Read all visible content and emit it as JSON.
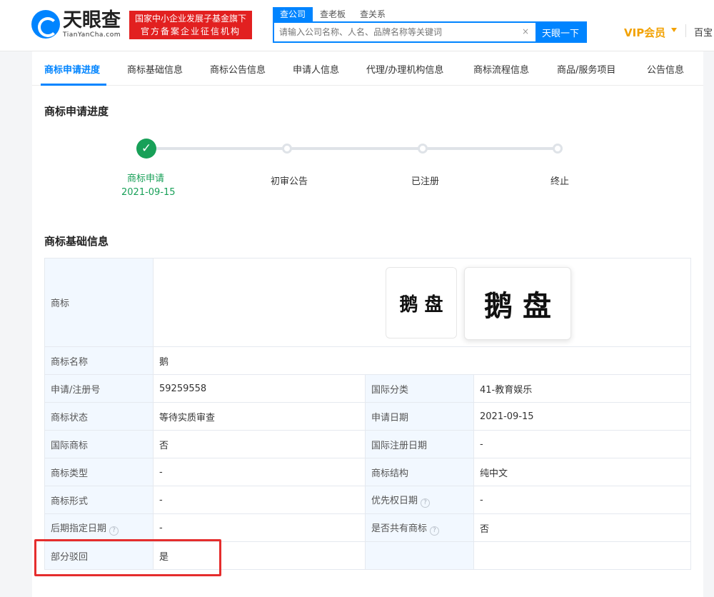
{
  "header": {
    "logo_title": "天眼查",
    "logo_sub": "TianYanCha.com",
    "tagline_line1": "国家中小企业发展子基金旗下",
    "tagline_line2": "官方备案企业征信机构",
    "search_tabs": [
      "查公司",
      "查老板",
      "查关系"
    ],
    "search_placeholder": "请输入公司名称、人名、品牌名称等关键词",
    "clear_icon": "×",
    "search_button": "天眼一下",
    "vip_label": "VIP会员",
    "baike": "百宝"
  },
  "nav": {
    "tabs": [
      "商标申请进度",
      "商标基础信息",
      "商标公告信息",
      "申请人信息",
      "代理/办理机构信息",
      "商标流程信息",
      "商品/服务项目",
      "公告信息"
    ]
  },
  "progress": {
    "title": "商标申请进度",
    "steps": [
      {
        "label": "商标申请",
        "date": "2021-09-15"
      },
      {
        "label": "初审公告"
      },
      {
        "label": "已注册"
      },
      {
        "label": "终止"
      }
    ],
    "check_icon": "✓"
  },
  "basic_info": {
    "title": "商标基础信息",
    "trademark_label": "商标",
    "trademark_image_text": "鹅 盘",
    "help_icon": "?",
    "rows": {
      "name_label": "商标名称",
      "name_value": "鹅",
      "reg_label": "申请/注册号",
      "reg_value": "59259558",
      "class_label": "国际分类",
      "class_value": "41-教育娱乐",
      "status_label": "商标状态",
      "status_value": "等待实质审查",
      "app_date_label": "申请日期",
      "app_date_value": "2021-09-15",
      "intl_label": "国际商标",
      "intl_value": "否",
      "intl_date_label": "国际注册日期",
      "intl_date_value": "-",
      "type_label": "商标类型",
      "type_value": "-",
      "structure_label": "商标结构",
      "structure_value": "纯中文",
      "form_label": "商标形式",
      "form_value": "-",
      "priority_label": "优先权日期",
      "priority_value": "-",
      "later_label": "后期指定日期",
      "later_value": "-",
      "shared_label": "是否共有商标",
      "shared_value": "否",
      "partial_label": "部分驳回",
      "partial_value": "是"
    }
  },
  "colors": {
    "accent": "#0084ff",
    "success": "#18a058",
    "vip": "#f2a100",
    "highlight": "#e52d2d"
  }
}
